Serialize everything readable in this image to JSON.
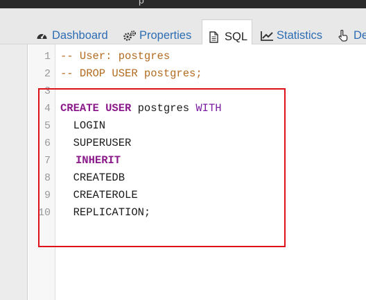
{
  "window": {
    "title_glyph": "p"
  },
  "tabs": [
    {
      "label": "Dashboard",
      "icon": "dashboard-icon"
    },
    {
      "label": "Properties",
      "icon": "gears-icon"
    },
    {
      "label": "SQL",
      "icon": "file-icon",
      "active": true
    },
    {
      "label": "Statistics",
      "icon": "line-chart-icon"
    },
    {
      "label": "De",
      "icon": "hand-pointer-icon"
    }
  ],
  "editor": {
    "lines": [
      {
        "no": "1",
        "text": "-- User: postgres"
      },
      {
        "no": "2",
        "text": "-- DROP USER postgres;"
      },
      {
        "no": "3",
        "text": ""
      },
      {
        "no": "4",
        "kw1": "CREATE USER",
        "plain": " postgres ",
        "kw2": "WITH"
      },
      {
        "no": "5",
        "text": "  LOGIN"
      },
      {
        "no": "6",
        "text": "  SUPERUSER"
      },
      {
        "no": "7",
        "kw1": "INHERIT"
      },
      {
        "no": "8",
        "text": "  CREATEDB"
      },
      {
        "no": "9",
        "text": "  CREATEROLE"
      },
      {
        "no": "10",
        "text": "  REPLICATION;"
      }
    ]
  },
  "colors": {
    "accent": "#2c6db3",
    "comment": "#b36b1f",
    "keyword": "#8a1a8a",
    "highlight": "#e0101a"
  }
}
